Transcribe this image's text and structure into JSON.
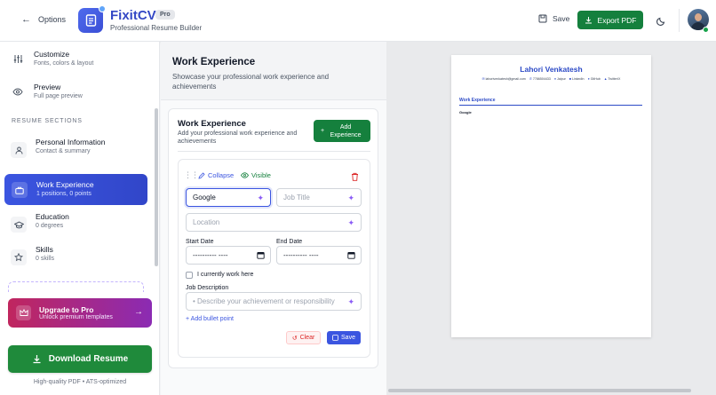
{
  "header": {
    "back_label": "Options",
    "app_name": "FixitCV",
    "badge": "Pro",
    "subtitle": "Professional Resume Builder",
    "save_label": "Save",
    "export_label": "Export PDF"
  },
  "sidebar": {
    "nav": [
      {
        "title": "Customize",
        "sub": "Fonts, colors & layout",
        "icon": "sliders-icon"
      },
      {
        "title": "Preview",
        "sub": "Full page preview",
        "icon": "eye-icon"
      }
    ],
    "section_label": "RESUME SECTIONS",
    "sections": [
      {
        "title": "Personal Information",
        "sub": "Contact & summary",
        "icon": "user-icon"
      },
      {
        "title": "Work Experience",
        "sub": "1 positions, 0 points",
        "icon": "briefcase-icon",
        "active": true
      },
      {
        "title": "Education",
        "sub": "0 degrees",
        "icon": "graduation-cap-icon"
      },
      {
        "title": "Skills",
        "sub": "0 skills",
        "icon": "star-icon"
      }
    ],
    "upgrade": {
      "title": "Upgrade to Pro",
      "sub": "Unlock premium templates"
    },
    "download_label": "Download Resume",
    "download_note": "High-quality PDF • ATS-optimized"
  },
  "editor": {
    "title": "Work Experience",
    "description": "Showcase your professional work experience and achievements",
    "card": {
      "title": "Work Experience",
      "description": "Add your professional work experience and achievements",
      "add_label": "Add Experience"
    },
    "entry": {
      "collapse_label": "Collapse",
      "visible_label": "Visible",
      "company_value": "Google",
      "job_title_placeholder": "Job Title",
      "location_placeholder": "Location",
      "start_label": "Start Date",
      "end_label": "End Date",
      "date_placeholder": "---------- ----",
      "current_label": "I currently work here",
      "desc_label": "Job Description",
      "desc_placeholder": "• Describe your achievement or responsibility",
      "add_bullet_label": "+ Add bullet point",
      "clear_label": "Clear",
      "save_label": "Save"
    }
  },
  "preview": {
    "name": "Lahori Venkatesh",
    "contacts": [
      {
        "icon": "mail-icon",
        "text": "lahorivenkatesh@gmail.com"
      },
      {
        "icon": "phone-icon",
        "text": "7786504433"
      },
      {
        "icon": "pin-icon",
        "text": "Jaipur"
      },
      {
        "icon": "linkedin-icon",
        "text": "LinkedIn"
      },
      {
        "icon": "github-icon",
        "text": "GitHub"
      },
      {
        "icon": "twitter-icon",
        "text": "Twitter/X"
      }
    ],
    "section_title": "Work Experience",
    "company": "Google"
  },
  "colors": {
    "brand": "#3448c5",
    "accent_blue": "#3b55e0",
    "green": "#15803d",
    "upgrade_from": "#c0265e",
    "upgrade_to": "#8b2bb3"
  }
}
